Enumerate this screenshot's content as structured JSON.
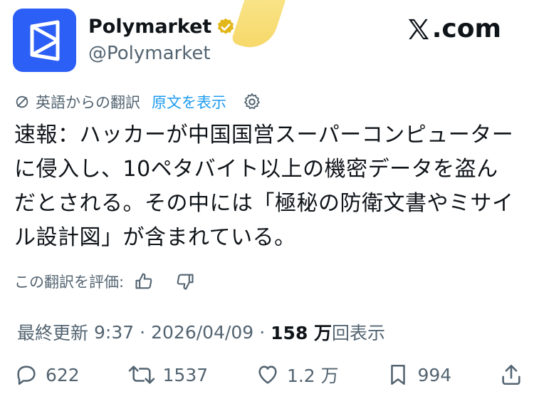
{
  "header": {
    "name": "Polymarket",
    "handle": "@Polymarket",
    "site": "X.com",
    "site_x": "X",
    "site_rest": ".com"
  },
  "translation": {
    "source_label": "英語からの翻訳",
    "show_original": "原文を表示"
  },
  "post": {
    "text": "速報：ハッカーが中国国営スーパーコンピューターに侵入し、10ペタバイト以上の機密データを盗んだとされる。その中には「極秘の防衛文書やミサイル設計図」が含まれている。"
  },
  "rating": {
    "label": "この翻訳を評価:"
  },
  "meta": {
    "updated_label": "最終更新",
    "time": "9:37",
    "separator1": "·",
    "date": "2026/04/09",
    "separator2": "·",
    "views_count": "158 万",
    "views_label": "回表示"
  },
  "actions": {
    "replies": "622",
    "reposts": "1537",
    "likes": "1.2 万",
    "bookmarks": "994"
  },
  "colors": {
    "avatar_bg": "#2c5ff6",
    "verified": "#e2b719",
    "link": "#1d9bf0",
    "muted": "#536471",
    "text": "#0f1419"
  }
}
